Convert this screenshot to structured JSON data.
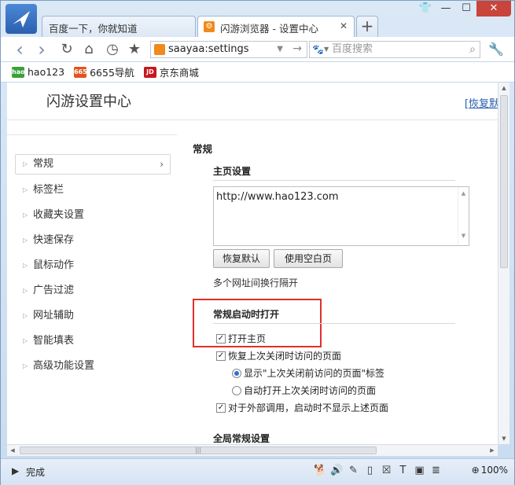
{
  "tabs": [
    {
      "label": "百度一下，你就知道",
      "active": false
    },
    {
      "label": "闪游浏览器 - 设置中心",
      "active": true
    }
  ],
  "new_tab_label": "+",
  "window_controls": {
    "skin": "👕",
    "minimize": "—",
    "maximize": "☐",
    "close": "✕"
  },
  "toolbar": {
    "back_icon": "‹",
    "forward_icon": "›",
    "reload_icon": "↻",
    "home_icon": "⌂",
    "history_icon": "◷",
    "favorite_icon": "★",
    "address": "saayaa:settings",
    "address_dropdown": "▼",
    "go_icon": "→",
    "search_placeholder": "百度搜索",
    "search_engine_icon": "🐾",
    "search_icon": "⌕",
    "tools_icon": "🔧"
  },
  "bookmarks": [
    {
      "label": "hao123",
      "icon_text": "hao",
      "color": "#3aa13a"
    },
    {
      "label": "6655导航",
      "icon_text": "6655",
      "color": "#e0541e"
    },
    {
      "label": "京东商城",
      "icon_text": "JD",
      "color": "#c8161d"
    }
  ],
  "page": {
    "title": "闪游设置中心",
    "restore_link": "[恢复默"
  },
  "sidebar": {
    "items": [
      {
        "label": "常规",
        "active": true
      },
      {
        "label": "标签栏"
      },
      {
        "label": "收藏夹设置"
      },
      {
        "label": "快速保存"
      },
      {
        "label": "鼠标动作"
      },
      {
        "label": "广告过滤"
      },
      {
        "label": "网址辅助"
      },
      {
        "label": "智能填表"
      },
      {
        "label": "高级功能设置"
      }
    ]
  },
  "main": {
    "section_title": "常规",
    "homepage": {
      "title": "主页设置",
      "url": "http://www.hao123.com",
      "restore_default_button": "恢复默认",
      "blank_page_button": "使用空白页",
      "hint": "多个网址间换行隔开"
    },
    "startup": {
      "title": "常规启动时打开",
      "open_homepage": {
        "label": "打开主页",
        "checked": true
      },
      "restore_last": {
        "label": "恢复上次关闭时访问的页面",
        "checked": true
      },
      "radio_show_tab": {
        "label": "显示\"上次关闭前访问的页面\"标签",
        "selected": true
      },
      "radio_auto_open": {
        "label": "自动打开上次关闭时访问的页面",
        "selected": false
      },
      "external_call": {
        "label": "对于外部调用，启动时不显示上述页面",
        "checked": true
      }
    },
    "global_title": "全局常规设置"
  },
  "statusbar": {
    "play_icon": "▶",
    "status": "完成",
    "zoom": "100%",
    "icons": [
      "dog-icon",
      "speaker-icon",
      "edit-icon",
      "page-icon",
      "close-box-icon",
      "text-icon",
      "image-icon",
      "layers-icon"
    ]
  },
  "colors": {
    "highlight": "#e0302a",
    "link": "#2a5fae",
    "accent_orange": "#f08a1c"
  }
}
